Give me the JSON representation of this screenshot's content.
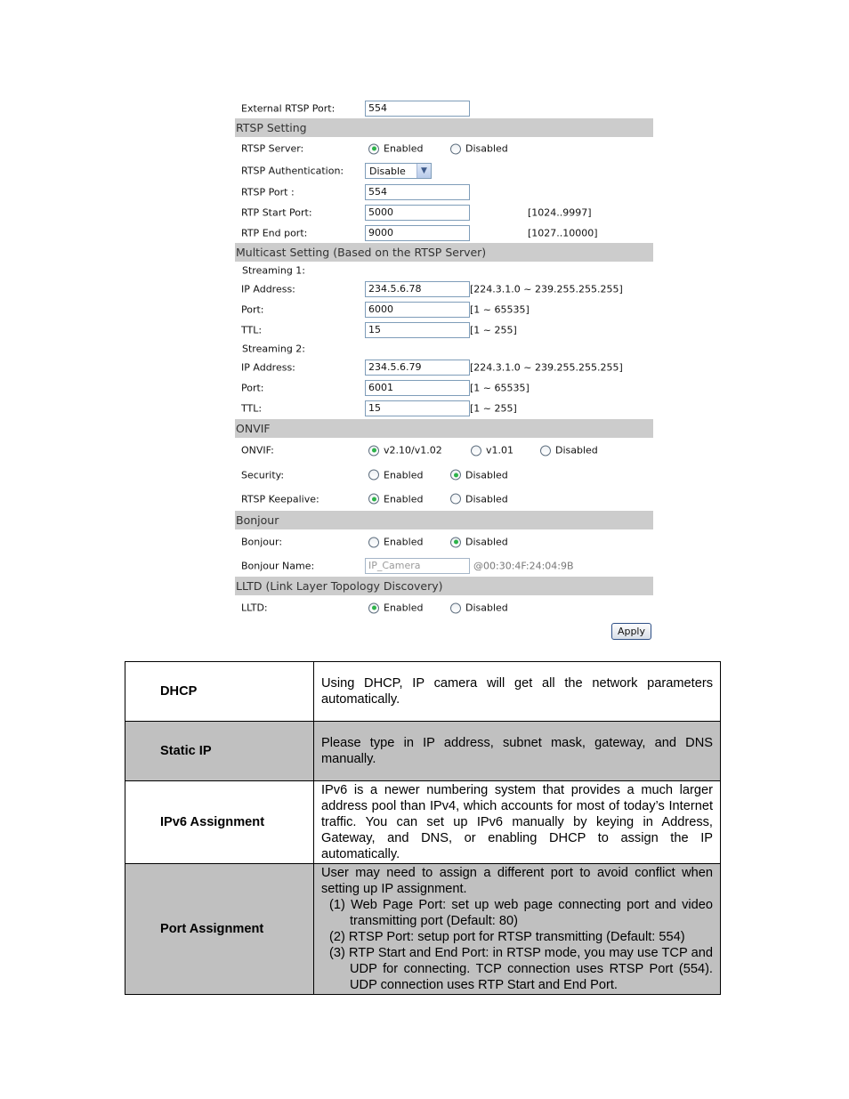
{
  "settings_panel": {
    "external_rtsp_port": {
      "label": "External RTSP Port:",
      "value": "554"
    },
    "rtsp_setting": {
      "title": "RTSP Setting",
      "rtsp_server": {
        "label": "RTSP Server:",
        "options": [
          "Enabled",
          "Disabled"
        ],
        "selected": "Enabled"
      },
      "rtsp_authentication": {
        "label": "RTSP Authentication:",
        "value": "Disable"
      },
      "rtsp_port": {
        "label": "RTSP Port :",
        "value": "554"
      },
      "rtp_start_port": {
        "label": "RTP Start Port:",
        "value": "5000",
        "range": "[1024..9997]"
      },
      "rtp_end_port": {
        "label": "RTP End port:",
        "value": "9000",
        "range": "[1027..10000]"
      }
    },
    "multicast_setting": {
      "title": "Multicast Setting (Based on the RTSP Server)",
      "streams": [
        {
          "label": "Streaming 1:",
          "ip_address": {
            "label": "IP Address:",
            "value": "234.5.6.78",
            "range": "[224.3.1.0 ~ 239.255.255.255]"
          },
          "port": {
            "label": "Port:",
            "value": "6000",
            "range": "[1 ~ 65535]"
          },
          "ttl": {
            "label": "TTL:",
            "value": "15",
            "range": "[1 ~ 255]"
          }
        },
        {
          "label": "Streaming 2:",
          "ip_address": {
            "label": "IP Address:",
            "value": "234.5.6.79",
            "range": "[224.3.1.0 ~ 239.255.255.255]"
          },
          "port": {
            "label": "Port:",
            "value": "6001",
            "range": "[1 ~ 65535]"
          },
          "ttl": {
            "label": "TTL:",
            "value": "15",
            "range": "[1 ~ 255]"
          }
        }
      ]
    },
    "onvif": {
      "title": "ONVIF",
      "onvif": {
        "label": "ONVIF:",
        "options": [
          "v2.10/v1.02",
          "v1.01",
          "Disabled"
        ],
        "selected": "v2.10/v1.02"
      },
      "security": {
        "label": "Security:",
        "options": [
          "Enabled",
          "Disabled"
        ],
        "selected": "Disabled"
      },
      "rtsp_keepalive": {
        "label": "RTSP Keepalive:",
        "options": [
          "Enabled",
          "Disabled"
        ],
        "selected": "Enabled"
      }
    },
    "bonjour": {
      "title": "Bonjour",
      "bonjour": {
        "label": "Bonjour:",
        "options": [
          "Enabled",
          "Disabled"
        ],
        "selected": "Disabled"
      },
      "bonjour_name": {
        "label": "Bonjour Name:",
        "value": "IP_Camera",
        "suffix": "@00:30:4F:24:04:9B"
      }
    },
    "lltd": {
      "title": "LLTD (Link Layer Topology Discovery)",
      "lltd": {
        "label": "LLTD:",
        "options": [
          "Enabled",
          "Disabled"
        ],
        "selected": "Enabled"
      }
    },
    "apply_label": "Apply"
  },
  "description_table": [
    {
      "term": "DHCP",
      "description": "Using DHCP, IP camera will get all the network parameters automatically."
    },
    {
      "term": "Static IP",
      "description": "Please type in IP address, subnet mask, gateway, and DNS manually."
    },
    {
      "term": "IPv6 Assignment",
      "description": "IPv6 is a newer numbering system that provides a much larger address pool than IPv4, which accounts for most of today’s Internet traffic. You can set up IPv6 manually by keying in Address, Gateway, and DNS, or enabling DHCP to assign the IP automatically."
    },
    {
      "term": "Port Assignment",
      "description": "User may need to assign a different port to avoid conflict when setting up IP assignment.",
      "items": [
        "(1) Web Page Port: set up web page connecting port and video transmitting port (Default: 80)",
        "(2) RTSP Port: setup port for RTSP transmitting (Default: 554)",
        "(3) RTP Start and End Port: in RTSP mode, you may use TCP and UDP for connecting. TCP connection uses RTSP Port (554). UDP connection uses RTP Start and End Port."
      ]
    }
  ]
}
